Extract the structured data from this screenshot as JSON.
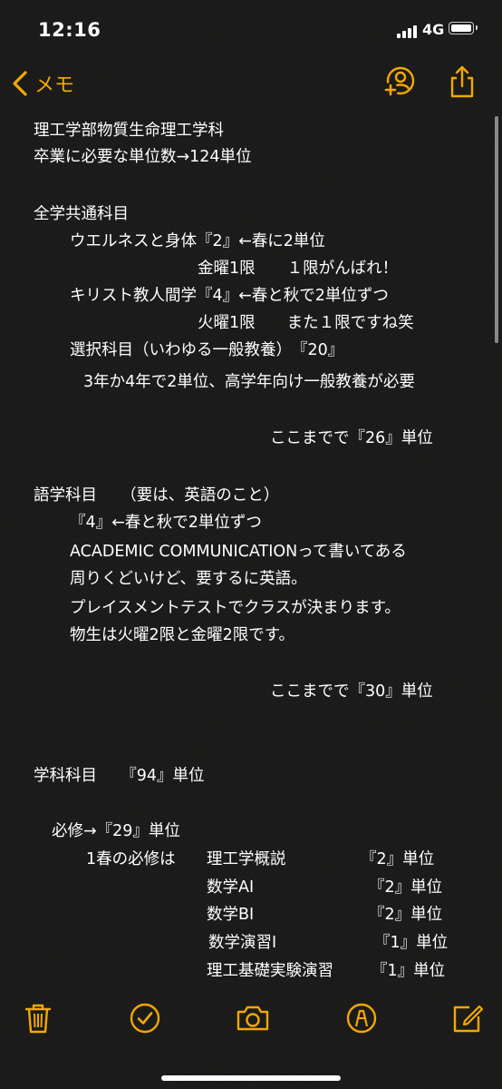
{
  "status": {
    "time": "12:16",
    "network": "4G"
  },
  "nav": {
    "back_label": "メモ"
  },
  "note": {
    "lines": [
      "理工学部物質生命理工学科",
      "卒業に必要な単位数→124単位",
      "全学共通科目",
      "ウエルネスと身体『2』←春に2単位",
      "金曜1限　　１限がんばれ！",
      "キリスト教人間学『4』←春と秋で2単位ずつ",
      "火曜1限　　また１限ですね笑",
      "選択科目（いわゆる一般教養）　『20』",
      "3年か4年で2単位、高学年向け一般教養が必要",
      "ここまでで『26』単位",
      "語学科目　　（要は、英語のこと）",
      "『4』←春と秋で2単位ずつ",
      "ACADEMIC COMMUNICATIONって書いてある",
      "周りくどいけど、要するに英語。",
      "プレイスメントテストでクラスが決まります。",
      "物生は火曜2限と金曜2限です。",
      "ここまでで『30』単位",
      "学科科目　　『94』単位",
      "必修→『29』単位",
      "1春の必修は",
      "理工学概説",
      "『2』単位",
      "数学AI",
      "『2』単位",
      "数学BI",
      "『2』単位",
      "数学演習Ⅰ",
      "『1』単位",
      "理工基礎実験演習",
      "『1』単位"
    ]
  },
  "colors": {
    "accent": "#f2a900",
    "background": "#1b1a19",
    "text": "#ffffff"
  },
  "icons": {
    "back": "chevron-left-icon",
    "add_person": "add-person-icon",
    "share": "share-icon",
    "trash": "trash-icon",
    "checklist": "checkmark-circle-icon",
    "camera": "camera-icon",
    "markup": "markup-pen-icon",
    "compose": "compose-icon"
  }
}
